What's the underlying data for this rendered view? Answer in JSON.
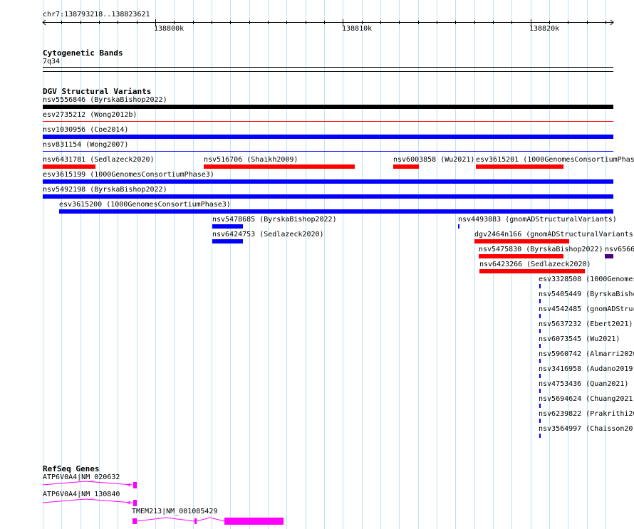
{
  "ruler": {
    "location": "chr7:138793218..138823621",
    "ticks": [
      "138800k",
      "138810k",
      "138820k"
    ]
  },
  "cytoband": {
    "title": "Cytogenetic Bands",
    "band": "7q34"
  },
  "dgv": {
    "title": "DGV Structural Variants",
    "labels": [
      "nsv5556846 (ByrskaBishop2022)",
      "esv2735212 (Wong2012b)",
      "nsv1030956 (Coe2014)",
      "nsv831154 (Wong2007)",
      "nsv6431781 (Sedlazeck2020)",
      "nsv516706 (Shaikh2009)",
      "nsv6003858 (Wu2021)",
      "esv3615201 (1000GenomesConsortiumPhase3)",
      "esv3615199 (1000GenomesConsortiumPhase3)",
      "nsv5492198 (ByrskaBishop2022)",
      "esv3615200 (1000GenomesConsortiumPhase3)",
      "nsv5478685 (ByrskaBishop2022)",
      "nsv4493883 (gnomADStructuralVariants)",
      "nsv6424753 (Sedlazeck2020)",
      "dgv2464n166 (gnomADStructuralVariants)",
      "nsv5475830 (ByrskaBishop2022)",
      "nsv6566",
      "nsv6423266 (Sedlazeck2020)",
      "esv3328508 (1000Genomes",
      "nsv5405449 (ByrskaBisho",
      "nsv4542485 (gnomADStruc",
      "nsv5637232 (Ebert2021)",
      "nsv6073545 (Wu2021)",
      "nsv5960742 (Almarri2020",
      "nsv3416958 (Audano2019",
      "nsv4753436 (Quan2021)",
      "nsv5694624 (Chuang2021",
      "nsv6239822 (Prakrithi20",
      "nsv3564997 (Chaisson20"
    ]
  },
  "refseq": {
    "title": "RefSeq Genes",
    "genes": [
      "ATP6V0A4|NM_020632",
      "ATP6V0A4|NM_130840",
      "TMEM213|NM_001085429"
    ]
  },
  "colors": {
    "loss": "#ff0000",
    "gain": "#0000ff",
    "complex": "#000000",
    "other": "#4b0082",
    "gene": "#ff00ff",
    "grid": "#bde3f5"
  }
}
